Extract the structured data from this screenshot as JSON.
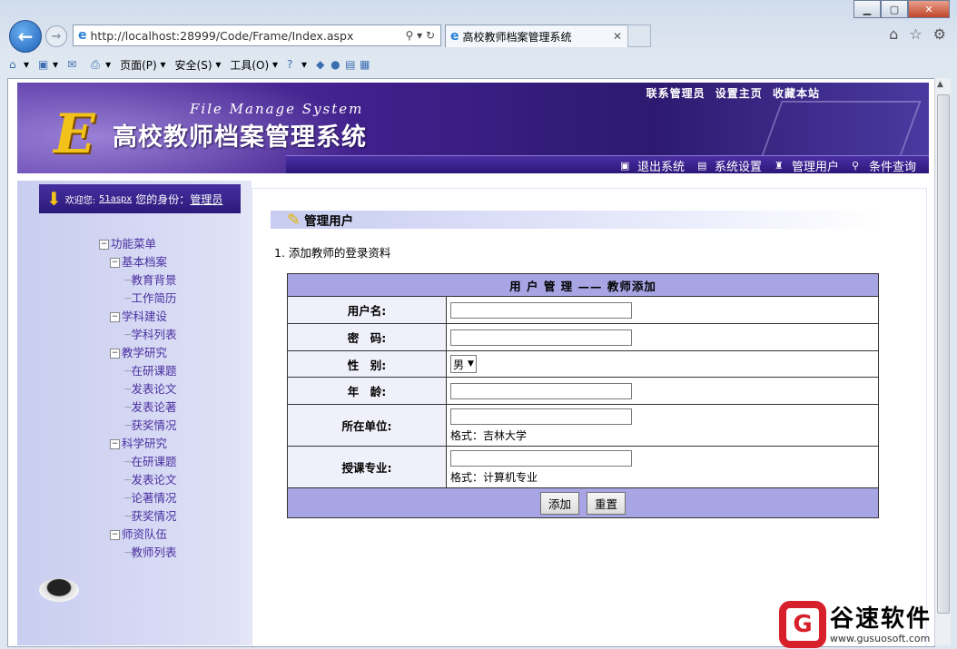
{
  "browser": {
    "url": "http://localhost:28999/Code/Frame/Index.aspx",
    "tab_title": "高校教师档案管理系统",
    "menu": {
      "page": "页面(P)",
      "safety": "安全(S)",
      "tools": "工具(O)"
    }
  },
  "banner": {
    "title_en": "File Manage System",
    "title_cn": "高校教师档案管理系统",
    "top_links": [
      "联系管理员",
      "设置主页",
      "收藏本站"
    ],
    "nav": [
      "退出系统",
      "系统设置",
      "管理用户",
      "条件查询"
    ]
  },
  "sidebar": {
    "welcome_label": "欢迎您:",
    "username": "51aspx",
    "role_label": "您的身份：",
    "role": "管理员",
    "tree": [
      {
        "label": "功能菜单",
        "level": 0
      },
      {
        "label": "基本档案",
        "level": 1
      },
      {
        "label": "教育背景",
        "level": 2
      },
      {
        "label": "工作简历",
        "level": 2
      },
      {
        "label": "学科建设",
        "level": 1
      },
      {
        "label": "学科列表",
        "level": 2
      },
      {
        "label": "教学研究",
        "level": 1
      },
      {
        "label": "在研课题",
        "level": 2
      },
      {
        "label": "发表论文",
        "level": 2
      },
      {
        "label": "发表论著",
        "level": 2
      },
      {
        "label": "获奖情况",
        "level": 2
      },
      {
        "label": "科学研究",
        "level": 1
      },
      {
        "label": "在研课题",
        "level": 2
      },
      {
        "label": "发表论文",
        "level": 2
      },
      {
        "label": "论著情况",
        "level": 2
      },
      {
        "label": "获奖情况",
        "level": 2
      },
      {
        "label": "师资队伍",
        "level": 1
      },
      {
        "label": "教师列表",
        "level": 2
      }
    ]
  },
  "main": {
    "title": "管理用户",
    "step": "1.  添加教师的登录资料",
    "form_title": "用 户 管 理 —— 教师添加",
    "fields": {
      "username": {
        "label": "用户名:",
        "value": ""
      },
      "password": {
        "label": "密　码:",
        "value": ""
      },
      "gender": {
        "label": "性　别:",
        "value": "男"
      },
      "age": {
        "label": "年　龄:",
        "value": ""
      },
      "unit": {
        "label": "所在单位:",
        "value": "",
        "hint": "格式：吉林大学"
      },
      "major": {
        "label": "授课专业:",
        "value": "",
        "hint": "格式：计算机专业"
      }
    },
    "add_button": "添加",
    "reset_button": "重置"
  },
  "watermark": {
    "cn": "谷速软件",
    "url": "www.gusuosoft.com",
    "letter": "G"
  }
}
